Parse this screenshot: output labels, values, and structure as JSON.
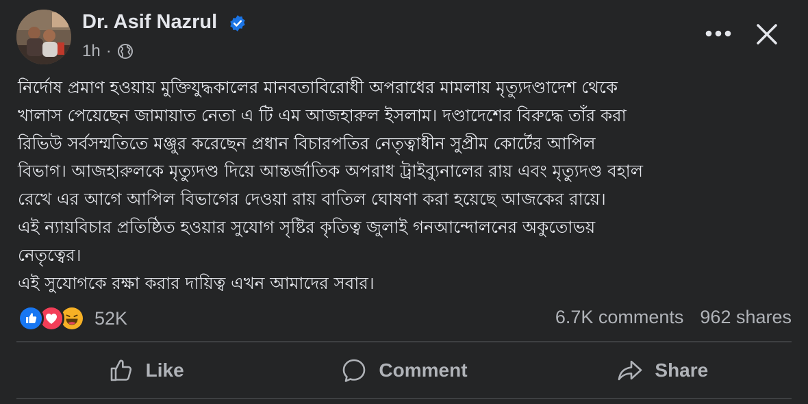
{
  "post": {
    "author": "Dr. Asif Nazrul",
    "time": "1h",
    "separator": "·",
    "body_lines": [
      "নির্দোষ প্রমাণ হওয়ায় মুক্তিযুদ্ধকালের মানবতাবিরোধী অপরাধের মামলায় মৃত্যুদণ্ডাদেশ থেকে",
      "খালাস পেয়েছেন জামায়াত নেতা এ টি এম আজহারুল ইসলাম। দণ্ডাদেশের বিরুদ্ধে তাঁর করা",
      "রিভিউ সর্বসম্মতিতে মঞ্জুর করেছেন প্রধান বিচারপতির নেতৃত্বাধীন সুপ্রীম কোর্টের আপিল",
      "বিভাগ। আজহারুলকে মৃত্যুদণ্ড দিয়ে আন্তর্জাতিক অপরাধ ট্রাইব্যুনালের রায় এবং মৃত্যুদণ্ড বহাল",
      "রেখে এর আগে আপিল বিভাগের দেওয়া রায় বাতিল ঘোষণা করা হয়েছে আজকের রায়ে।",
      "এই ন্যায়বিচার প্রতিষ্ঠিত হওয়ার সুযোগ সৃষ্টির কৃতিত্ব জুলাই গনআন্দোলনের অকুতোভয়",
      "নেতৃত্বের।",
      "এই সুযোগকে রক্ষা করার দায়িত্ব এখন আমাদের সবার।"
    ]
  },
  "engagement": {
    "reaction_count": "52K",
    "comments": "6.7K comments",
    "shares": "962 shares"
  },
  "actions": {
    "like": "Like",
    "comment": "Comment",
    "share": "Share"
  },
  "icons": {
    "verified": "verified-badge-icon",
    "privacy": "globe-icon",
    "more": "more-options-icon",
    "close": "close-icon",
    "reactions": [
      "like-reaction-icon",
      "love-reaction-icon",
      "haha-reaction-icon"
    ]
  },
  "colors": {
    "background": "#242526",
    "text_primary": "#e4e6eb",
    "text_secondary": "#b0b3b8",
    "verified_blue": "#1b74e4",
    "divider": "#3e4042",
    "like_blue": "#1877f2",
    "love_red": "#f33e58",
    "haha_yellow": "#f7b125"
  }
}
